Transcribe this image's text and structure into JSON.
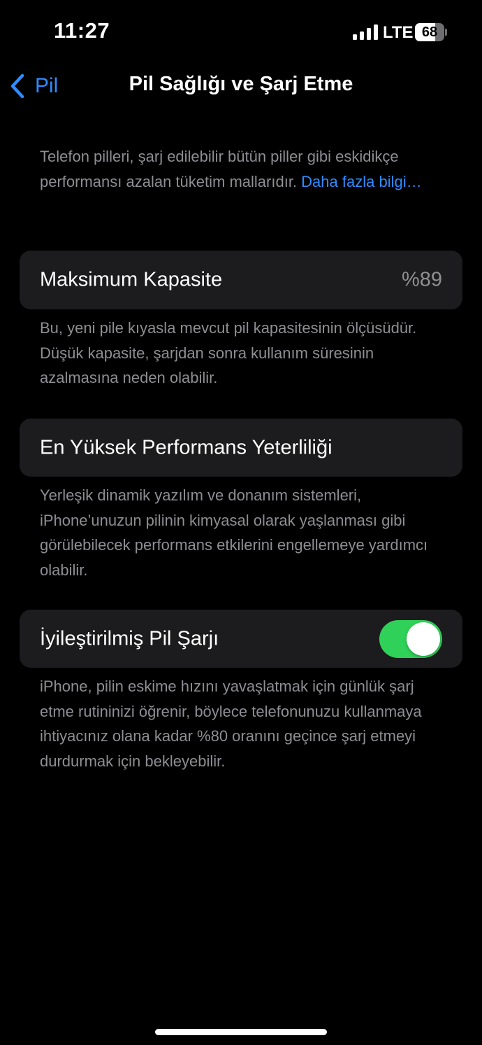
{
  "status_bar": {
    "time": "11:27",
    "network": "LTE",
    "battery_level": "68",
    "battery_fraction": 0.68
  },
  "nav": {
    "back_label": "Pil",
    "title": "Pil Sağlığı ve Şarj Etme"
  },
  "intro": {
    "text": "Telefon pilleri, şarj edilebilir bütün piller gibi eskidikçe performansı azalan tüketim mallarıdır.",
    "link": "Daha fazla bilgi…"
  },
  "max_capacity": {
    "label": "Maksimum Kapasite",
    "value": "%89",
    "footnote": "Bu, yeni pile kıyasla mevcut pil kapasitesinin ölçüsüdür. Düşük kapasite, şarjdan sonra kullanım süresinin azalmasına neden olabilir."
  },
  "peak_performance": {
    "label": "En Yüksek Performans Yeterliliği",
    "footnote": "Yerleşik dinamik yazılım ve donanım sistemleri, iPhone’unuzun pilinin kimyasal olarak yaşlanması gibi görülebilecek performans etkilerini engellemeye yardımcı olabilir."
  },
  "optimized_charging": {
    "label": "İyileştirilmiş Pil Şarjı",
    "enabled": true,
    "footnote": "iPhone, pilin eskime hızını yavaşlatmak için günlük şarj etme rutininizi öğrenir, böylece telefonunuzu kullanmaya ihtiyacınız olana kadar %80 oranını geçince şarj etmeyi durdurmak için bekleyebilir."
  },
  "colors": {
    "accent": "#2f8cff",
    "toggle_on": "#30d158",
    "card_bg": "#1c1c1e",
    "secondary_text": "#8e8e93"
  }
}
